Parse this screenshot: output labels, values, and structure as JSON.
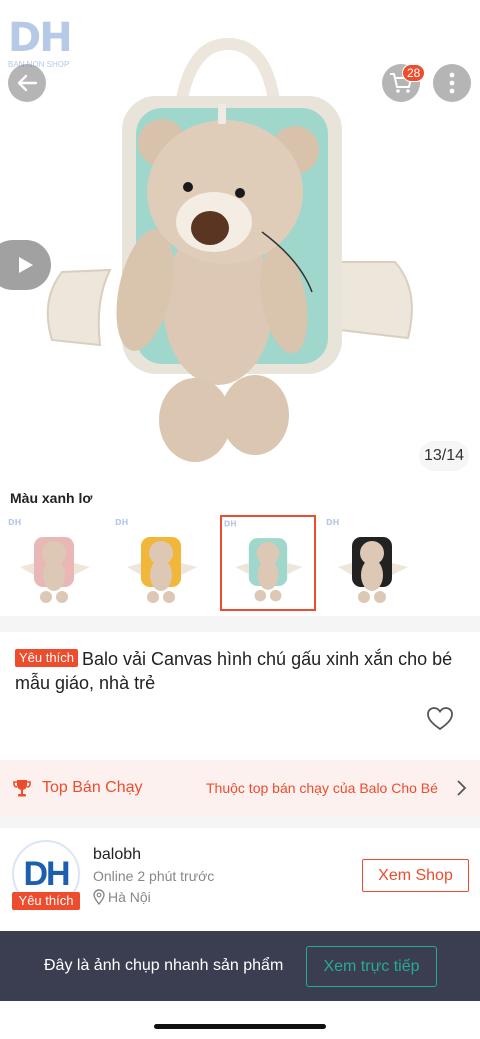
{
  "header": {
    "logo_text": "DH",
    "logo_subtext": "BAN NON SHOP",
    "cart_count": "28",
    "image_counter": "13/14"
  },
  "icons": {
    "back": "back-arrow-icon",
    "cart": "cart-icon",
    "more": "more-vertical-icon",
    "play": "play-icon",
    "heart": "heart-icon",
    "trophy": "trophy-icon",
    "chevron": "chevron-right-icon",
    "location": "location-pin-icon"
  },
  "variants": {
    "selected_label": "Màu xanh lơ",
    "items": [
      {
        "color": "#e9b8b6",
        "name": "pink"
      },
      {
        "color": "#f0b73a",
        "name": "yellow"
      },
      {
        "color": "#9fd7cd",
        "name": "mint"
      },
      {
        "color": "#222222",
        "name": "black"
      }
    ],
    "selected_index": 2
  },
  "product": {
    "badge": "Yêu thích",
    "title": "Balo vải Canvas hình chú gấu xinh xắn cho bé mẫu giáo, nhà trẻ"
  },
  "top_selling": {
    "label": "Top Bán Chạy",
    "detail": "Thuộc top bán chạy của Balo Cho Bé"
  },
  "shop": {
    "logo_text": "DH",
    "badge": "Yêu thích",
    "name": "balobh",
    "status": "Online 2 phút trước",
    "location": "Hà Nội",
    "view_button": "Xem Shop"
  },
  "snapshot": {
    "message": "Đây là ảnh chụp nhanh sản phẩm",
    "button": "Xem trực tiếp"
  },
  "colors": {
    "accent": "#ee4d2d",
    "teal": "#26aa99",
    "banner_bg": "#3a3e50"
  }
}
